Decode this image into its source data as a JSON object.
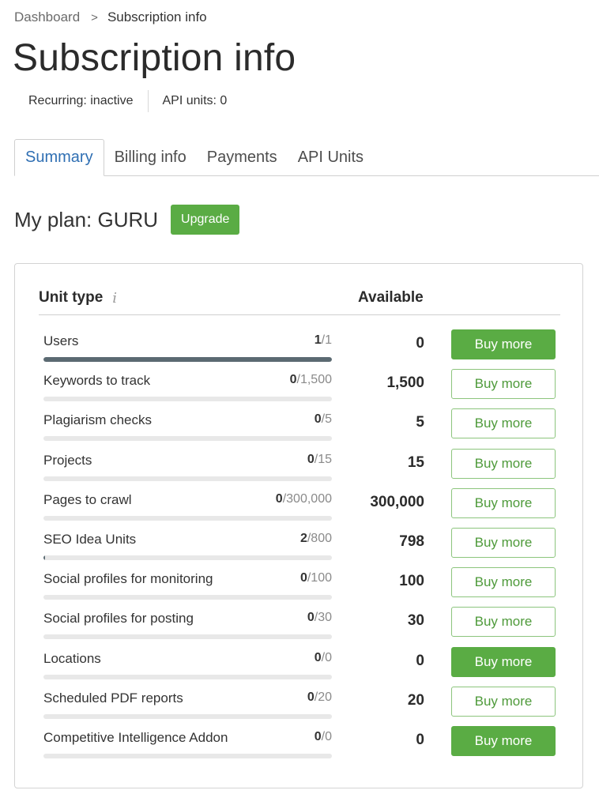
{
  "breadcrumb": {
    "parent": "Dashboard",
    "separator": ">",
    "current": "Subscription info"
  },
  "page_title": "Subscription info",
  "meta": {
    "recurring": "Recurring: inactive",
    "api_units": "API units: 0"
  },
  "tabs": [
    {
      "label": "Summary",
      "active": true
    },
    {
      "label": "Billing info",
      "active": false
    },
    {
      "label": "Payments",
      "active": false
    },
    {
      "label": "API Units",
      "active": false
    }
  ],
  "plan": {
    "label": "My plan: GURU",
    "upgrade_label": "Upgrade"
  },
  "table": {
    "col_unit_type": "Unit type",
    "info_icon": "i",
    "col_available": "Available",
    "rows": [
      {
        "name": "Users",
        "used": "1",
        "limit": "1",
        "usage_fraction": 1.0,
        "available": "0",
        "button": "Buy more",
        "button_style": "filled"
      },
      {
        "name": "Keywords to track",
        "used": "0",
        "limit": "1,500",
        "usage_fraction": 0,
        "available": "1,500",
        "button": "Buy more",
        "button_style": "outline"
      },
      {
        "name": "Plagiarism checks",
        "used": "0",
        "limit": "5",
        "usage_fraction": 0,
        "available": "5",
        "button": "Buy more",
        "button_style": "outline"
      },
      {
        "name": "Projects",
        "used": "0",
        "limit": "15",
        "usage_fraction": 0,
        "available": "15",
        "button": "Buy more",
        "button_style": "outline"
      },
      {
        "name": "Pages to crawl",
        "used": "0",
        "limit": "300,000",
        "usage_fraction": 0,
        "available": "300,000",
        "button": "Buy more",
        "button_style": "outline"
      },
      {
        "name": "SEO Idea Units",
        "used": "2",
        "limit": "800",
        "usage_fraction": 0.0025,
        "available": "798",
        "button": "Buy more",
        "button_style": "outline"
      },
      {
        "name": "Social profiles for monitoring",
        "used": "0",
        "limit": "100",
        "usage_fraction": 0,
        "available": "100",
        "button": "Buy more",
        "button_style": "outline"
      },
      {
        "name": "Social profiles for posting",
        "used": "0",
        "limit": "30",
        "usage_fraction": 0,
        "available": "30",
        "button": "Buy more",
        "button_style": "outline"
      },
      {
        "name": "Locations",
        "used": "0",
        "limit": "0",
        "usage_fraction": 0,
        "available": "0",
        "button": "Buy more",
        "button_style": "filled"
      },
      {
        "name": "Scheduled PDF reports",
        "used": "0",
        "limit": "20",
        "usage_fraction": 0,
        "available": "20",
        "button": "Buy more",
        "button_style": "outline"
      },
      {
        "name": "Competitive Intelligence Addon",
        "used": "0",
        "limit": "0",
        "usage_fraction": 0,
        "available": "0",
        "button": "Buy more",
        "button_style": "filled"
      }
    ]
  },
  "colors": {
    "accent_green": "#5aac44",
    "link_blue": "#2f6fb3",
    "bar_fill": "#5b6a72"
  }
}
